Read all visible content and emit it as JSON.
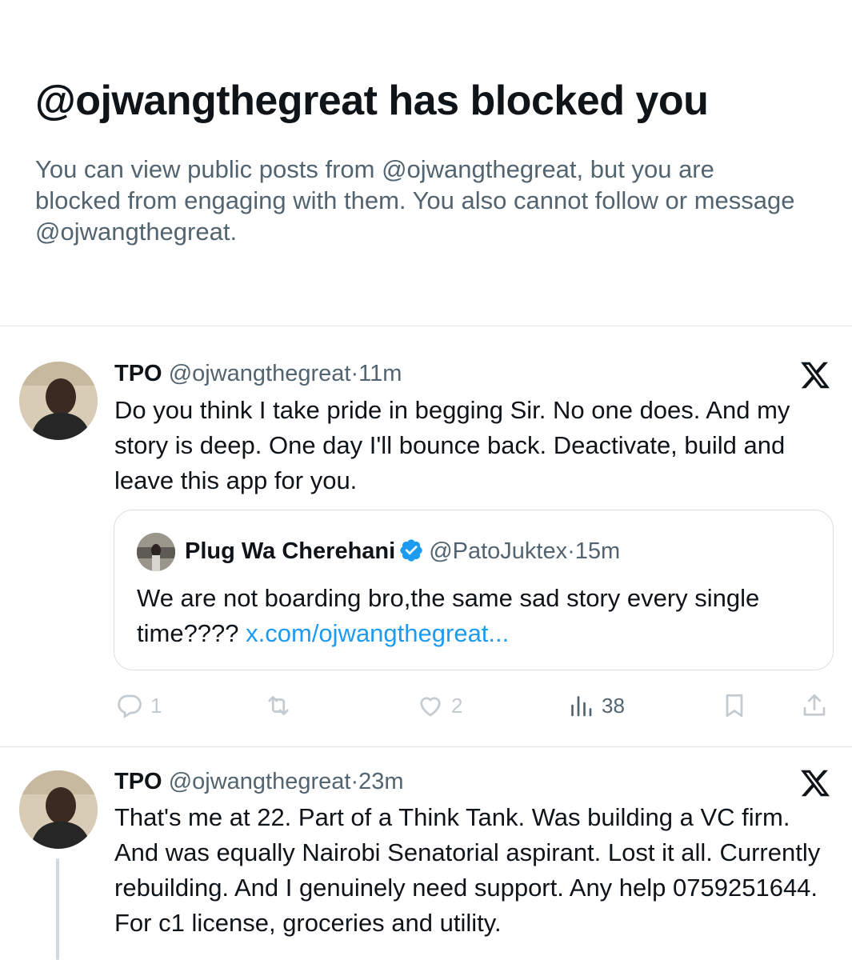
{
  "block_notice": {
    "title": "@ojwangthegreat has blocked you",
    "description": "You can view public posts from @ojwangthegreat, but you are blocked from engaging with them. You also cannot follow or message @ojwangthegreat."
  },
  "posts": [
    {
      "author_name": "TPO",
      "author_handle": "@ojwangthegreat",
      "separator": "·",
      "time": "11m",
      "text": "Do you think I take pride in begging Sir. No one does. And my story is deep. One day I'll bounce back. Deactivate, build and leave this app for you.",
      "quote": {
        "author_name": "Plug Wa Cherehani",
        "author_handle": "@PatoJuktex",
        "separator": "·",
        "time": "15m",
        "text": "We are not boarding bro,the same sad story every single time???? ",
        "link_text": "x.com/ojwangthegreat...",
        "verified": true
      },
      "actions": {
        "replies": "1",
        "reposts": "",
        "likes": "2",
        "views": "38"
      }
    },
    {
      "author_name": "TPO",
      "author_handle": "@ojwangthegreat",
      "separator": "·",
      "time": "23m",
      "text": "That's me at 22. Part of a Think Tank. Was building a VC firm. And was equally Nairobi Senatorial aspirant. Lost it all. Currently rebuilding. And I genuinely need support. Any help 0759251644. For c1 license, groceries and utility."
    }
  ],
  "colors": {
    "text_primary": "#0f1419",
    "text_secondary": "#536471",
    "link": "#1d9bf0",
    "verified": "#1d9bf0",
    "divider": "#e2e6e9",
    "action_disabled": "#c3cbd1"
  },
  "icons": {
    "brand": "x-logo-icon",
    "verified": "verified-badge-icon",
    "reply": "reply-icon",
    "repost": "repost-icon",
    "like": "heart-icon",
    "views": "views-icon",
    "bookmark": "bookmark-icon",
    "share": "share-icon"
  }
}
